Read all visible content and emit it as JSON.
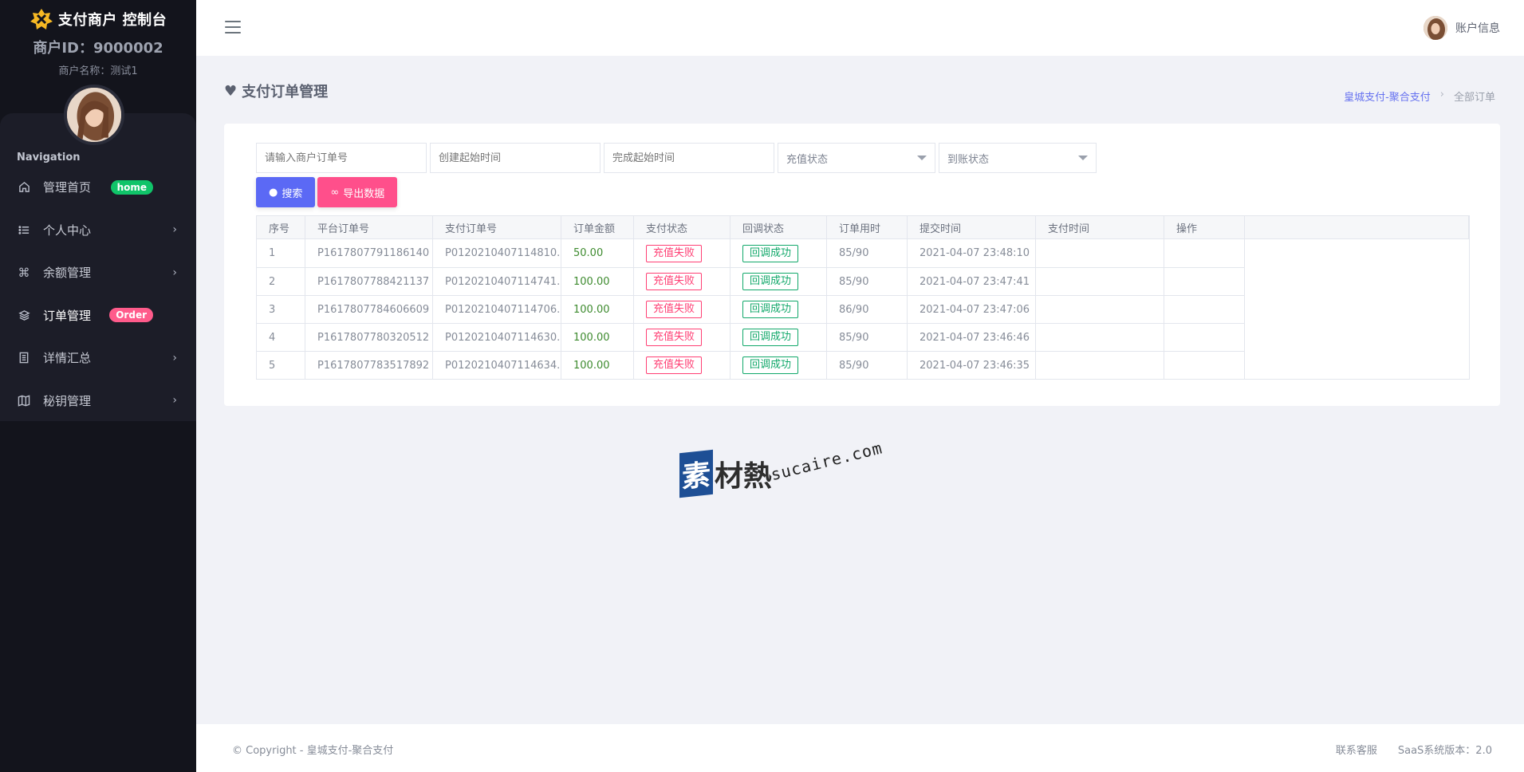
{
  "sidebar": {
    "brand_title": "支付商户 控制台",
    "merchant_id": "商户ID：9000002",
    "merchant_name": "商户名称：测试1",
    "nav_heading": "Navigation",
    "items": [
      {
        "label": "管理首页",
        "badge": "home",
        "icon": "home-icon"
      },
      {
        "label": "个人中心",
        "icon": "list-icon"
      },
      {
        "label": "余额管理",
        "icon": "command-icon"
      },
      {
        "label": "订单管理",
        "badge": "Order",
        "icon": "layers-icon"
      },
      {
        "label": "详情汇总",
        "icon": "document-icon"
      },
      {
        "label": "秘钥管理",
        "icon": "map-icon"
      }
    ]
  },
  "topbar": {
    "account_label": "账户信息"
  },
  "page": {
    "title": "支付订单管理",
    "breadcrumb": {
      "link": "皇城支付-聚合支付",
      "sep": "›",
      "current": "全部订单"
    }
  },
  "filters": {
    "order_no_placeholder": "请输入商户订单号",
    "create_time_placeholder": "创建起始时间",
    "finish_time_placeholder": "完成起始时间",
    "recharge_status": "充值状态",
    "arrival_status": "到账状态",
    "search_label": "搜索",
    "export_label": "导出数据"
  },
  "table": {
    "headers": [
      "序号",
      "平台订单号",
      "支付订单号",
      "订单金额",
      "支付状态",
      "回调状态",
      "订单用时",
      "提交时间",
      "支付时间",
      "操作"
    ],
    "rows": [
      {
        "idx": "1",
        "platform_no": "P1617807791186140",
        "pay_no": "P0120210407114810...",
        "amount": "50.00",
        "pay_status": "充值失败",
        "callback_status": "回调成功",
        "duration": "85/90",
        "submit_time": "2021-04-07 23:48:10",
        "pay_time": "",
        "action": ""
      },
      {
        "idx": "2",
        "platform_no": "P1617807788421137",
        "pay_no": "P0120210407114741...",
        "amount": "100.00",
        "pay_status": "充值失败",
        "callback_status": "回调成功",
        "duration": "85/90",
        "submit_time": "2021-04-07 23:47:41",
        "pay_time": "",
        "action": ""
      },
      {
        "idx": "3",
        "platform_no": "P1617807784606609",
        "pay_no": "P0120210407114706...",
        "amount": "100.00",
        "pay_status": "充值失败",
        "callback_status": "回调成功",
        "duration": "86/90",
        "submit_time": "2021-04-07 23:47:06",
        "pay_time": "",
        "action": ""
      },
      {
        "idx": "4",
        "platform_no": "P1617807780320512",
        "pay_no": "P0120210407114630...",
        "amount": "100.00",
        "pay_status": "充值失败",
        "callback_status": "回调成功",
        "duration": "85/90",
        "submit_time": "2021-04-07 23:46:46",
        "pay_time": "",
        "action": ""
      },
      {
        "idx": "5",
        "platform_no": "P1617807783517892",
        "pay_no": "P0120210407114634...",
        "amount": "100.00",
        "pay_status": "充值失败",
        "callback_status": "回调成功",
        "duration": "85/90",
        "submit_time": "2021-04-07 23:46:35",
        "pay_time": "",
        "action": ""
      }
    ]
  },
  "watermark": {
    "box_char": "素",
    "text": "材熱",
    "url": "sucaire.com"
  },
  "footer": {
    "copyright": "© Copyright - 皇城支付-聚合支付",
    "support": "联系客服",
    "version": "SaaS系统版本：2.0"
  },
  "colors": {
    "sidebar_bg": "#13141c",
    "primary": "#5b69f5",
    "pink": "#ff4f8b",
    "success": "#10c469",
    "fail": "#ff3f74"
  }
}
